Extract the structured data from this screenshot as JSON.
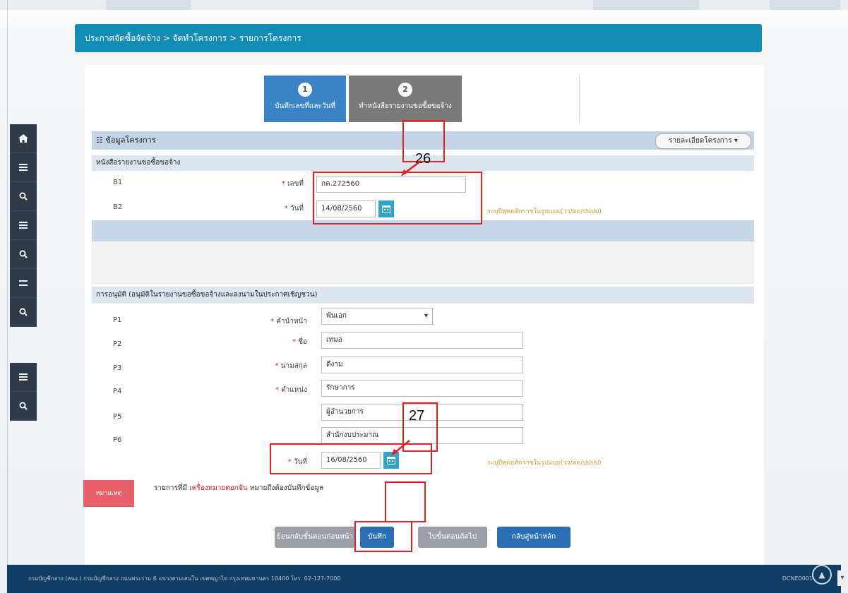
{
  "header": {
    "breadcrumb": "ประกาศจัดซื้อจัดจ้าง > จัดทำโครงการ > รายการโครงการ"
  },
  "steps": [
    {
      "number": "1",
      "label": "บันทึกเลขที่และวันที่"
    },
    {
      "number": "2",
      "label": "ทำหนังสือรายงานขอซื้อขอจ้าง"
    }
  ],
  "project_info": {
    "title": "ข้อมูลโครงการ",
    "details_button": "รายละเอียดโครงการ ▾"
  },
  "report_section": {
    "title": "หนังสือรายงานขอซื้อขอจ้าง",
    "rows": [
      {
        "code": "B1",
        "label": "เลขที่",
        "value": "กค.272560"
      },
      {
        "code": "B2",
        "label": "วันที่",
        "value": "14/08/2560",
        "hint": "ระบุปีพุทธศักราชในรูปแบบ(วว/ดด/ปปปป)"
      }
    ]
  },
  "approval_section": {
    "title": "การอนุมัติ (อนุมัติในรายงานขอซื้อขอจ้างและลงนามในประกาศเชิญชวน)",
    "rows": [
      {
        "code": "P1",
        "label": "คำนำหน้า",
        "value": "พันเอก"
      },
      {
        "code": "P2",
        "label": "ชื่อ",
        "value": "เทมอ"
      },
      {
        "code": "P3",
        "label": "นามสกุล",
        "value": "ดีงาม"
      },
      {
        "code": "P4",
        "label": "ตำแหน่ง",
        "value": "รักษาการ"
      },
      {
        "code": "P5",
        "label": "",
        "value": "ผู้อำนวยการ"
      },
      {
        "code": "P6",
        "label": "",
        "value": "สำนักงบประมาณ"
      },
      {
        "code": "",
        "label": "วันที่",
        "value": "16/08/2560",
        "hint": "ระบุปีพุทธศักราชในรูปแบบ(วว/ดด/ปปปป)"
      }
    ]
  },
  "note": {
    "tag": "หมายเหตุ",
    "text_prefix": "รายการที่มี ",
    "text_red": "เครื่องหมายดอกจัน",
    "text_suffix": " หมายถึงต้องบันทึกข้อมูล"
  },
  "buttons": {
    "back_step": "ย้อนกลับขั้นตอนก่อนหน้า",
    "save": "บันทึก",
    "next_step": "ไปขั้นตอนถัดไป",
    "home": "กลับสู่หน้าหลัก"
  },
  "callouts": {
    "first": "26",
    "second": "27"
  },
  "footer": {
    "text": "กรมบัญชีกลาง (สนง.) กรมบัญชีกลาง ถนนพระราม 6 แขวงสามเสนใน เขตพญาไท กรุงเทพมหานคร 10400 โทร. 02-127-7000",
    "version": "DCNE0001"
  },
  "colors": {
    "header": "#138db4",
    "step_active": "#3b83c6",
    "step_inactive": "#7a7a7a",
    "annotation": "#e21f26",
    "footer": "#0f3d63"
  }
}
